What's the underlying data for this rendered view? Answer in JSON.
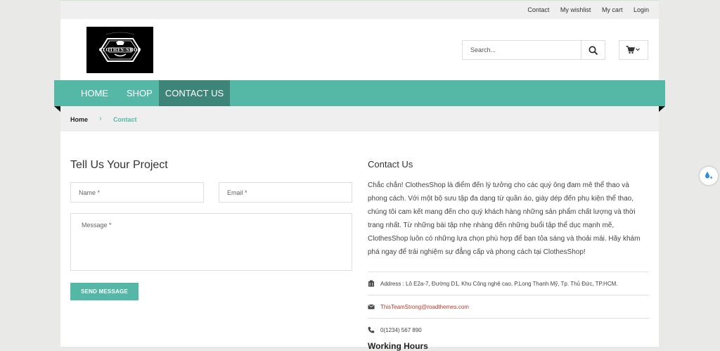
{
  "topbar": {
    "links": [
      "Contact",
      "My wishlist",
      "My cart",
      "Login"
    ]
  },
  "logo": {
    "text": "CLOTHES-SHOP"
  },
  "search": {
    "placeholder": "Search..."
  },
  "nav": {
    "items": [
      "HOME",
      "SHOP",
      "CONTACT US"
    ],
    "active": "CONTACT US"
  },
  "breadcrumb": {
    "home": "Home",
    "current": "Contact"
  },
  "form": {
    "title": "Tell Us Your Project",
    "name_placeholder": "Name *",
    "email_placeholder": "Email *",
    "message_placeholder": "Message *",
    "send_label": "SEND MESSAGE"
  },
  "contact": {
    "title": "Contact Us",
    "description": "Chắc chắn! ClothesShop là điểm đến lý tưởng cho các quý ông đam mê thể thao và phong cách. Với một bộ sưu tập đa dạng từ quần áo, giày dép đến phụ kiện thể thao, chúng tôi cam kết mang đến cho quý khách hàng những sản phẩm chất lượng và thời trang nhất. Từ những bài tập nhẹ nhàng đến những buổi tập thể dục mạnh mẽ, ClothesShop luôn có những lựa chọn phù hợp để bạn tỏa sáng và thoải mái. Hãy khám phá ngay để trải nghiệm sự đẳng cấp và phong cách tại ClothesShop!",
    "address": "Address : Lô E2a-7, Đường D1, Khu Công nghệ cao, P.Long Thạnh Mỹ, Tp. Thủ Đức, TP.HCM.",
    "email": "ThisTeamStrong@roadthemes.com",
    "phone": "0(1234) 567 890",
    "working_hours_title": "Working Hours"
  },
  "colors": {
    "accent": "#55b8a6",
    "nav_active": "#3d8578",
    "link": "#c0392b"
  }
}
